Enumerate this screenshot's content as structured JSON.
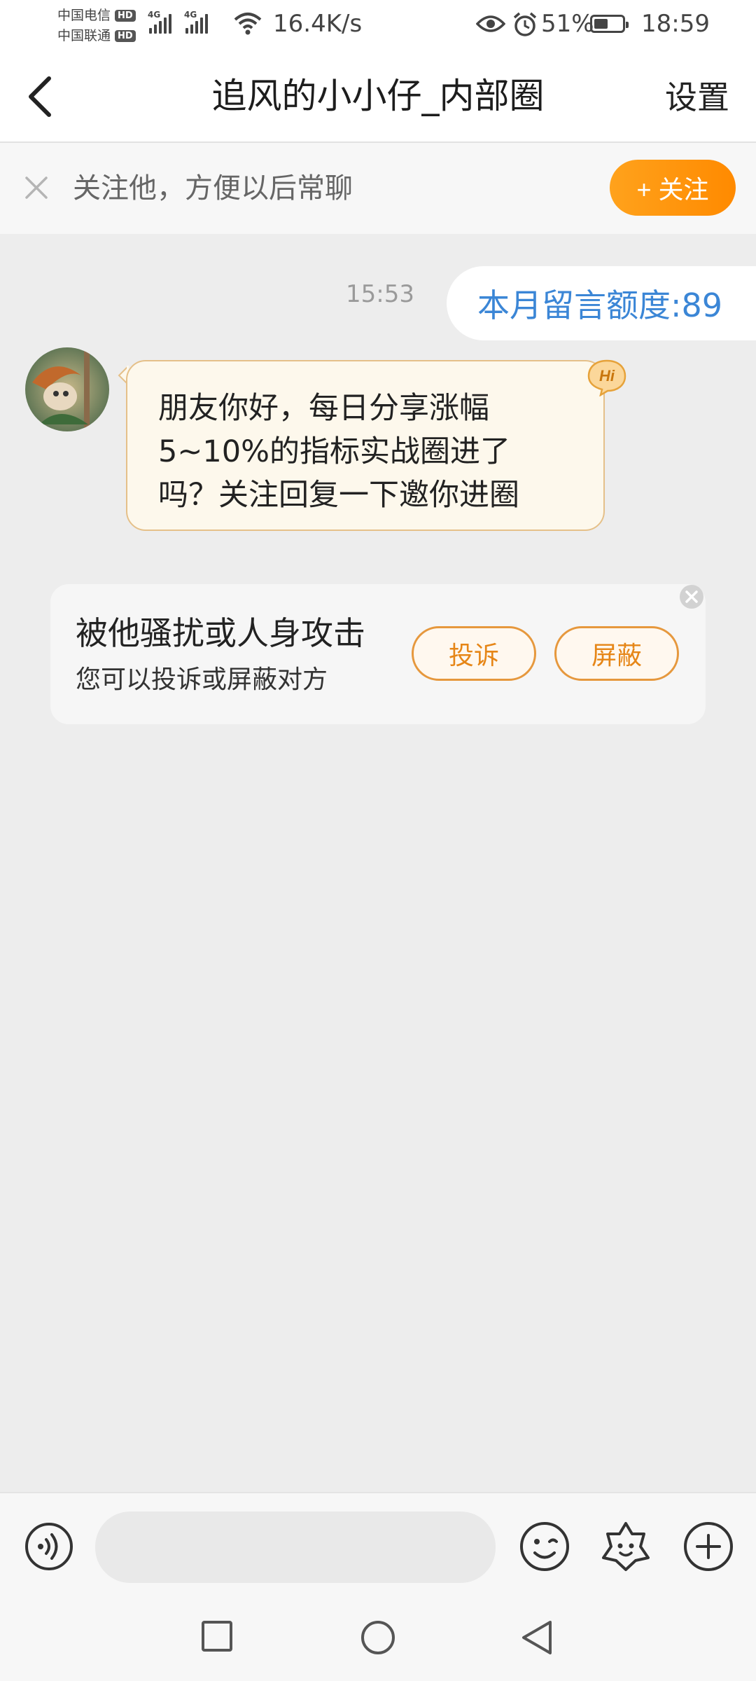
{
  "status_bar": {
    "carrier_1": "中国电信",
    "carrier_2": "中国联通",
    "hd_label": "HD",
    "network_type": "4G",
    "net_speed": "16.4K/s",
    "battery_percent": "51%",
    "battery_level": 0.51,
    "time": "18:59"
  },
  "header": {
    "title": "追风的小小仔_内部圈",
    "settings_label": "设置"
  },
  "follow_bar": {
    "text": "关注他，方便以后常聊",
    "button_label": "+ 关注"
  },
  "messages": {
    "timestamp": "15:53",
    "sent_text": "本月留言额度:89",
    "received_lines": [
      "朋友你好，每日分享涨幅",
      "5~10%的指标实战圈进了",
      "吗？关注回复一下邀你进圈"
    ],
    "hi_badge": "Hi"
  },
  "report_card": {
    "title": "被他骚扰或人身攻击",
    "subtitle": "您可以投诉或屏蔽对方",
    "report_button": "投诉",
    "block_button": "屏蔽"
  },
  "colors": {
    "accent_orange": "#ff8a00",
    "link_blue": "#3b86d6",
    "bubble_bg": "#fdf8ec",
    "bubble_border": "#e5c089"
  }
}
